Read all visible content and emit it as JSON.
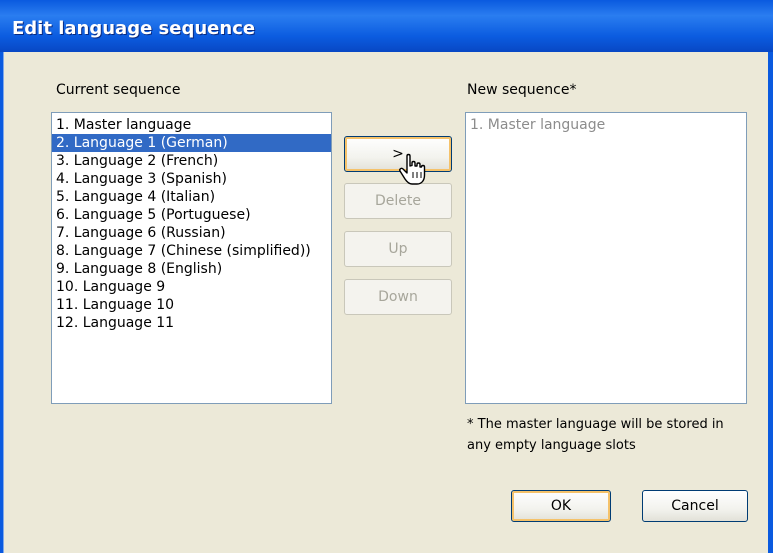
{
  "window": {
    "title": "Edit language sequence"
  },
  "current": {
    "label": "Current sequence",
    "items": [
      {
        "label": "1. Master language"
      },
      {
        "label": "2. Language 1 (German)",
        "selected": true
      },
      {
        "label": "3. Language 2 (French)"
      },
      {
        "label": "4. Language 3 (Spanish)"
      },
      {
        "label": "5. Language 4 (Italian)"
      },
      {
        "label": "6. Language 5 (Portuguese)"
      },
      {
        "label": "7. Language 6 (Russian)"
      },
      {
        "label": "8. Language 7 (Chinese (simplified))"
      },
      {
        "label": "9. Language 8 (English)"
      },
      {
        "label": "10. Language 9"
      },
      {
        "label": "11. Language 10"
      },
      {
        "label": "12. Language 11"
      }
    ]
  },
  "newseq": {
    "label": "New sequence*",
    "items": [
      {
        "label": "1. Master language"
      }
    ]
  },
  "buttons": {
    "add": ">",
    "delete": "Delete",
    "up": "Up",
    "down": "Down",
    "ok": "OK",
    "cancel": "Cancel"
  },
  "note": {
    "line1": "* The master language will be stored in",
    "line2": "any empty language slots"
  },
  "colors": {
    "titlebar": "#0a5adf",
    "selection": "#316ac5",
    "dialog_bg": "#ece9d8"
  }
}
